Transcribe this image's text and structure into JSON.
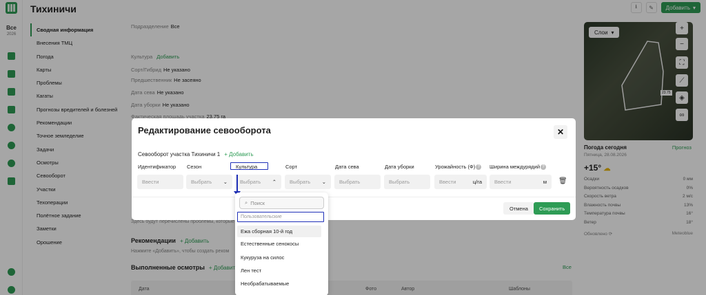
{
  "app": {
    "title": "Тихиничи",
    "add_label": "Добавить"
  },
  "season": {
    "label": "Все",
    "year": "2026"
  },
  "nav": [
    {
      "label": "Сводная информация",
      "active": true
    },
    {
      "label": "Внесения ТМЦ"
    },
    {
      "label": "Погода"
    },
    {
      "label": "Карты"
    },
    {
      "label": "Проблемы"
    },
    {
      "label": "Кагаты"
    },
    {
      "label": "Прогнозы вредителей и болезней"
    },
    {
      "label": "Рекомендации"
    },
    {
      "label": "Точное земледелие"
    },
    {
      "label": "Задачи"
    },
    {
      "label": "Осмотры"
    },
    {
      "label": "Севооборот"
    },
    {
      "label": "Участки"
    },
    {
      "label": "Техоперации"
    },
    {
      "label": "Полётное задание"
    },
    {
      "label": "Заметки"
    },
    {
      "label": "Орошение"
    }
  ],
  "info": {
    "subdivision_label": "Подразделение",
    "subdivision_value": "Все",
    "culture_label": "Культура",
    "culture_add": "Добавить",
    "sort_label": "Сорт/Гибрид",
    "sort_value": "Не указано",
    "pred_label": "Предшественник",
    "pred_value": "Не засеяно",
    "sow_label": "Дата сева",
    "sow_value": "Не указано",
    "harvest_label": "Дата уборки",
    "harvest_value": "Не указано",
    "area_label": "Фактическая площадь участка",
    "area_value": "23.75 га"
  },
  "problems_hint": "Здесь будут перечислены проблемы, которые",
  "recommendations": {
    "title": "Рекомендации",
    "add": "Добавить",
    "hint": "Нажмите «Добавить», чтобы создать реком"
  },
  "inspections": {
    "title": "Выполненные осмотры",
    "add": "Добавить",
    "all": "Все",
    "cols": [
      "Дата",
      "Фото",
      "Автор",
      "Шаблоны"
    ]
  },
  "map": {
    "layers_label": "Слои",
    "area_badge": "23.75"
  },
  "weather": {
    "title": "Погода сегодня",
    "forecast": "Прогноз",
    "date": "Пятница, 28.08.2026",
    "temp": "+15°",
    "rows": [
      {
        "label": "Осадки",
        "value": "0 мм"
      },
      {
        "label": "Вероятность осадков",
        "value": "0%"
      },
      {
        "label": "Скорость ветра",
        "value": "2 м/с"
      },
      {
        "label": "Влажность почвы",
        "value": "13%"
      },
      {
        "label": "Температура почвы",
        "value": "16°"
      },
      {
        "label": "Ветер",
        "value": "18°"
      }
    ],
    "updated": "Обновлено",
    "source": "Meteoblue"
  },
  "modal": {
    "title": "Редактирование севооборота",
    "subtitle": "Севооборот участка Тихиничи 1",
    "add": "Добавить",
    "columns": [
      "Идентификатор",
      "Сезон",
      "Культура",
      "Сорт",
      "Дата сева",
      "Дата уборки",
      "Урожайность (Ф)",
      "Ширина междурядий"
    ],
    "fields": {
      "id_ph": "Ввести",
      "season_ph": "Выбрать",
      "culture_ph": "Выбрать",
      "sort_ph": "Выбрать",
      "sow_ph": "Выбрать",
      "harvest_ph": "Выбрать",
      "yield_ph": "Ввести",
      "yield_unit": "ц/га",
      "width_ph": "Ввести",
      "width_unit": "м"
    },
    "cancel": "Отмена",
    "save": "Сохранить"
  },
  "dropdown": {
    "search_placeholder": "Поиск",
    "group": "Пользовательские",
    "options": [
      "Ежа сборная 10-й год",
      "Естественные сенокосы",
      "Кукуруза на силос",
      "Лен тест",
      "Необрабатываемые"
    ]
  }
}
